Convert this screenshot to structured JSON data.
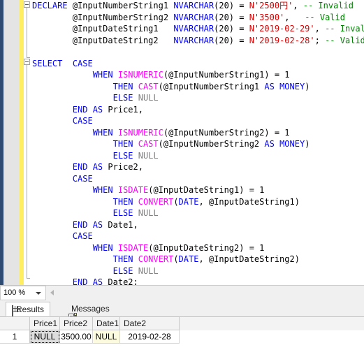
{
  "editor": {
    "language": "tsql",
    "colors": {
      "keyword": "#0000ff",
      "function": "#ff00ff",
      "string": "#dd0000",
      "comment": "#008000",
      "null_literal": "#808080",
      "change_bar": "#ffee62",
      "margin": "#e4e4e4",
      "navy_strip": "#2d4b73"
    },
    "lines": [
      "DECLARE @InputNumberString1 NVARCHAR(20) = N'2500円', -- Invalid",
      "        @InputNumberString2 NVARCHAR(20) = N'3500',   -- Valid",
      "        @InputDateString1   NVARCHAR(20) = N'2019-02-29', -- Invalid",
      "        @InputDateString2   NVARCHAR(20) = N'2019-02-28'; -- Valid",
      "",
      "SELECT  CASE",
      "            WHEN ISNUMERIC(@InputNumberString1) = 1",
      "                THEN CAST(@InputNumberString1 AS MONEY)",
      "                ELSE NULL",
      "        END AS Price1,",
      "        CASE",
      "            WHEN ISNUMERIC(@InputNumberString2) = 1",
      "                THEN CAST(@InputNumberString2 AS MONEY)",
      "                ELSE NULL",
      "        END AS Price2,",
      "        CASE",
      "            WHEN ISDATE(@InputDateString1) = 1",
      "                THEN CONVERT(DATE, @InputDateString1)",
      "                ELSE NULL",
      "        END AS Date1,",
      "        CASE",
      "            WHEN ISDATE(@InputDateString2) = 1",
      "                THEN CONVERT(DATE, @InputDateString2)",
      "                ELSE NULL",
      "        END AS Date2;"
    ]
  },
  "zoombar": {
    "zoom_level": "100 %",
    "dropdown_icon": "chevron-down-icon",
    "scroll_left_icon": "triangle-left-icon"
  },
  "results_pane": {
    "tabs": [
      {
        "label": "Results",
        "icon": "grid-icon",
        "active": true
      },
      {
        "label": "Messages",
        "icon": "message-icon",
        "active": false
      }
    ],
    "grid": {
      "row_header": "",
      "columns": [
        "Price1",
        "Price2",
        "Date1",
        "Date2"
      ],
      "rows": [
        {
          "number": "1",
          "cells": [
            "NULL",
            "3500.00",
            "NULL",
            "2019-02-28"
          ]
        }
      ],
      "selected_cell": "NULL",
      "highlighted_null_color": "#fcfbdf"
    }
  }
}
